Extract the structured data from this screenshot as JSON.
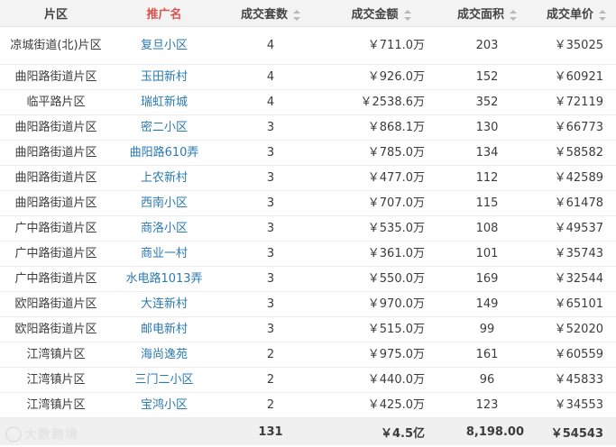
{
  "columns": [
    {
      "label": "片区",
      "sortable": false,
      "highlight": false
    },
    {
      "label": "推广名",
      "sortable": false,
      "highlight": true
    },
    {
      "label": "成交套数",
      "sortable": true,
      "highlight": false
    },
    {
      "label": "成交金额",
      "sortable": true,
      "highlight": false
    },
    {
      "label": "成交面积",
      "sortable": true,
      "highlight": false
    },
    {
      "label": "成交单价",
      "sortable": true,
      "highlight": false
    }
  ],
  "rows": [
    {
      "area": "凉城街道(北)片区",
      "name": "复旦小区",
      "count": "4",
      "amount": "￥711.0万",
      "size": "203",
      "price": "￥35025"
    },
    {
      "area": "曲阳路街道片区",
      "name": "玉田新村",
      "count": "4",
      "amount": "￥926.0万",
      "size": "152",
      "price": "￥60921"
    },
    {
      "area": "临平路片区",
      "name": "瑞虹新城",
      "count": "4",
      "amount": "￥2538.6万",
      "size": "352",
      "price": "￥72119"
    },
    {
      "area": "曲阳路街道片区",
      "name": "密二小区",
      "count": "3",
      "amount": "￥868.1万",
      "size": "130",
      "price": "￥66773"
    },
    {
      "area": "曲阳路街道片区",
      "name": "曲阳路610弄",
      "count": "3",
      "amount": "￥785.0万",
      "size": "134",
      "price": "￥58582"
    },
    {
      "area": "曲阳路街道片区",
      "name": "上农新村",
      "count": "3",
      "amount": "￥477.0万",
      "size": "112",
      "price": "￥42589"
    },
    {
      "area": "曲阳路街道片区",
      "name": "西南小区",
      "count": "3",
      "amount": "￥707.0万",
      "size": "115",
      "price": "￥61478"
    },
    {
      "area": "广中路街道片区",
      "name": "商洛小区",
      "count": "3",
      "amount": "￥535.0万",
      "size": "108",
      "price": "￥49537"
    },
    {
      "area": "广中路街道片区",
      "name": "商业一村",
      "count": "3",
      "amount": "￥361.0万",
      "size": "101",
      "price": "￥35743"
    },
    {
      "area": "广中路街道片区",
      "name": "水电路1013弄",
      "count": "3",
      "amount": "￥550.0万",
      "size": "169",
      "price": "￥32544"
    },
    {
      "area": "欧阳路街道片区",
      "name": "大连新村",
      "count": "3",
      "amount": "￥970.0万",
      "size": "149",
      "price": "￥65101"
    },
    {
      "area": "欧阳路街道片区",
      "name": "邮电新村",
      "count": "3",
      "amount": "￥515.0万",
      "size": "99",
      "price": "￥52020"
    },
    {
      "area": "江湾镇片区",
      "name": "海尚逸苑",
      "count": "2",
      "amount": "￥975.0万",
      "size": "161",
      "price": "￥60559"
    },
    {
      "area": "江湾镇片区",
      "name": "三门二小区",
      "count": "2",
      "amount": "￥440.0万",
      "size": "96",
      "price": "￥45833"
    },
    {
      "area": "江湾镇片区",
      "name": "宝鸿小区",
      "count": "2",
      "amount": "￥425.0万",
      "size": "123",
      "price": "￥34553"
    }
  ],
  "totals": {
    "area": "",
    "name": "",
    "count": "131",
    "amount": "￥4.5亿",
    "size": "8,198.00",
    "price": "￥54543"
  },
  "watermark": "大数跨境",
  "colors": {
    "header_bg": "#f3f3f3",
    "link": "#2a7ab0",
    "highlight": "#d9534f",
    "footer_bg": "#f0f0f0"
  }
}
